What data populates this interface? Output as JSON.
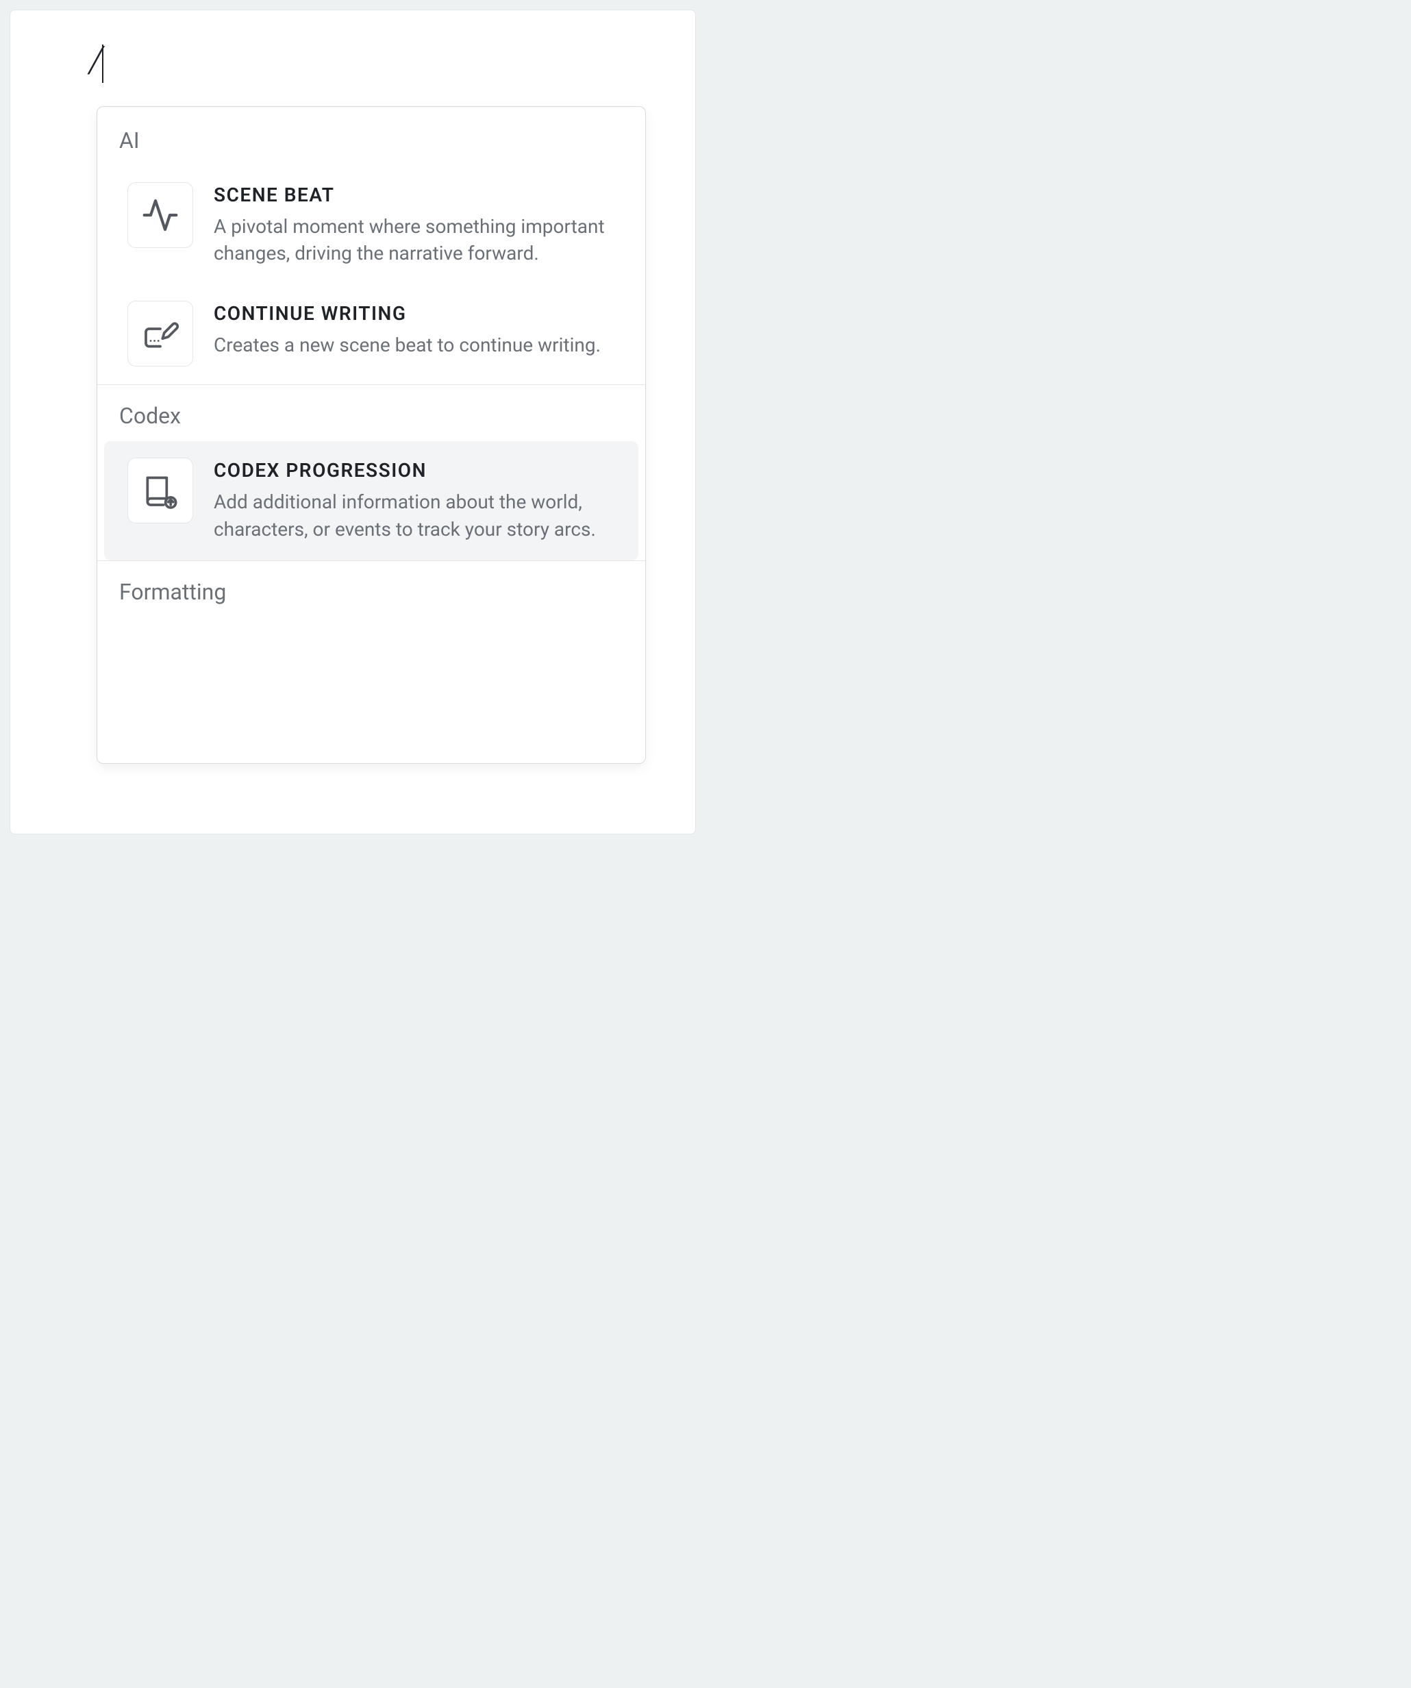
{
  "editor": {
    "typed": "/"
  },
  "menu": {
    "sections": [
      {
        "id": "ai",
        "label": "AI",
        "items": [
          {
            "id": "scene-beat",
            "icon": "activity-icon",
            "title": "SCENE BEAT",
            "description": "A pivotal moment where something important changes, driving the narrative forward."
          },
          {
            "id": "continue-writing",
            "icon": "continue-writing-icon",
            "title": "CONTINUE WRITING",
            "description": "Creates a new scene beat to continue writing."
          }
        ]
      },
      {
        "id": "codex",
        "label": "Codex",
        "items": [
          {
            "id": "codex-progression",
            "icon": "codex-progression-icon",
            "title": "CODEX PROGRESSION",
            "description": "Add additional information about the world, characters, or events to track your story arcs.",
            "highlighted": true
          }
        ]
      },
      {
        "id": "formatting",
        "label": "Formatting",
        "items": []
      }
    ]
  }
}
